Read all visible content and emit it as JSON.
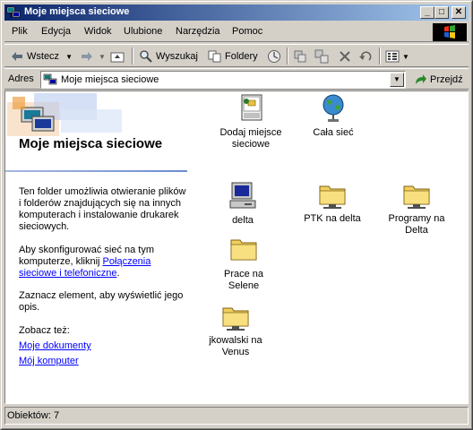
{
  "window": {
    "title": "Moje miejsca sieciowe"
  },
  "menu": [
    "Plik",
    "Edycja",
    "Widok",
    "Ulubione",
    "Narzędzia",
    "Pomoc"
  ],
  "toolbar": {
    "back": "Wstecz",
    "search": "Wyszukaj",
    "folders": "Foldery"
  },
  "address": {
    "label": "Adres",
    "value": "Moje miejsca sieciowe",
    "go": "Przejdź"
  },
  "left_panel": {
    "title": "Moje miejsca sieciowe",
    "description": "Ten folder umożliwia otwieranie plików i folderów znajdujących się na innych komputerach i instalowanie drukarek sieciowych.",
    "hint1_text": "Aby skonfigurować sieć na tym komputerze, kliknij ",
    "hint1_link": "Połączenia sieciowe i telefoniczne",
    "hint1_end": ".",
    "hint2": "Zaznacz element, aby wyświetlić jego opis.",
    "see_also": "Zobacz też:",
    "links": [
      "Moje dokumenty",
      "Mój komputer"
    ]
  },
  "items": [
    {
      "label": "Dodaj miejsce sieciowe",
      "icon": "add-network-place-icon"
    },
    {
      "label": "Cała sieć",
      "icon": "entire-network-globe-icon"
    },
    {
      "label": "delta",
      "icon": "computer-icon"
    },
    {
      "label": "PTK na delta",
      "icon": "shared-folder-icon"
    },
    {
      "label": "Programy na Delta",
      "icon": "shared-folder-icon"
    },
    {
      "label": "Prace na Selene",
      "icon": "folder-icon"
    },
    {
      "label": "jkowalski na Venus",
      "icon": "shared-folder-icon"
    }
  ],
  "status": {
    "text": "Obiektów: 7"
  }
}
